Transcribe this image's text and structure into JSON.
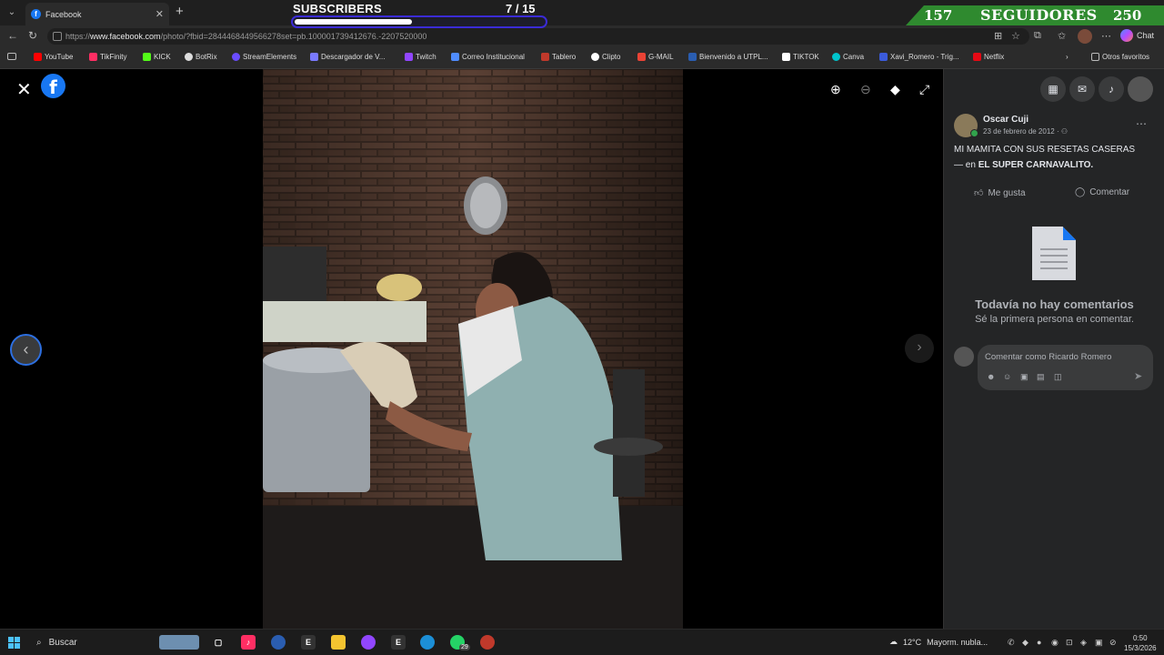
{
  "browser": {
    "tab_title": "Facebook",
    "url_prefix": "https://",
    "url_domain": "www.facebook.com",
    "url_rest": "/photo/?fbid=2844468449566278set=pb.100001739412676.-2207520000",
    "chat_label": "Chat"
  },
  "bookmarks": [
    {
      "label": "YouTube",
      "color": "#ff0000"
    },
    {
      "label": "TikFinity",
      "color": "#ff2e63"
    },
    {
      "label": "KICK",
      "color": "#53fc18"
    },
    {
      "label": "BotRix",
      "color": "#dddddd"
    },
    {
      "label": "StreamElements",
      "color": "#6a4cff"
    },
    {
      "label": "Descargador de V...",
      "color": "#7a7aff"
    },
    {
      "label": "Twitch",
      "color": "#9146ff"
    },
    {
      "label": "Correo Institucional",
      "color": "#4f8cff"
    },
    {
      "label": "Tablero",
      "color": "#c0392b"
    },
    {
      "label": "Clipto",
      "color": "#ffffff"
    },
    {
      "label": "G-MAIL",
      "color": "#ea4335"
    },
    {
      "label": "Bienvenido a UTPL...",
      "color": "#2a5db0"
    },
    {
      "label": "TIKTOK",
      "color": "#ffffff"
    },
    {
      "label": "Canva",
      "color": "#00c4cc"
    },
    {
      "label": "Xavi_Romero - Trig...",
      "color": "#3b5bdb"
    },
    {
      "label": "Netflix",
      "color": "#e50914"
    }
  ],
  "other_favorites": "Otros favoritos",
  "stream_overlay": {
    "subscribers_label": "SUBSCRIBERS",
    "subscribers_count": "7 / 15",
    "subscribers_progress": 0.47,
    "followers_current": "157",
    "followers_label": "SEGUIDORES",
    "followers_goal": "250"
  },
  "post": {
    "author": "Oscar Cuji",
    "date": "23 de febrero de 2012 · ",
    "caption_line1": "MI MAMITA CON SUS RESETAS CASERAS",
    "caption_prefix": "— en ",
    "caption_place": "EL SUPER CARNAVALITO.",
    "like_label": "Me gusta",
    "comment_label": "Comentar",
    "no_comments_title": "Todavía no hay comentarios",
    "no_comments_sub": "Sé la primera persona en comentar.",
    "comment_placeholder": "Comentar como Ricardo Romero"
  },
  "taskbar": {
    "search_label": "Buscar",
    "temperature": "12°C",
    "weather_text": "Mayorm. nubla...",
    "time": "0:50",
    "date": "15/3/2026",
    "whatsapp_badge": "29"
  }
}
